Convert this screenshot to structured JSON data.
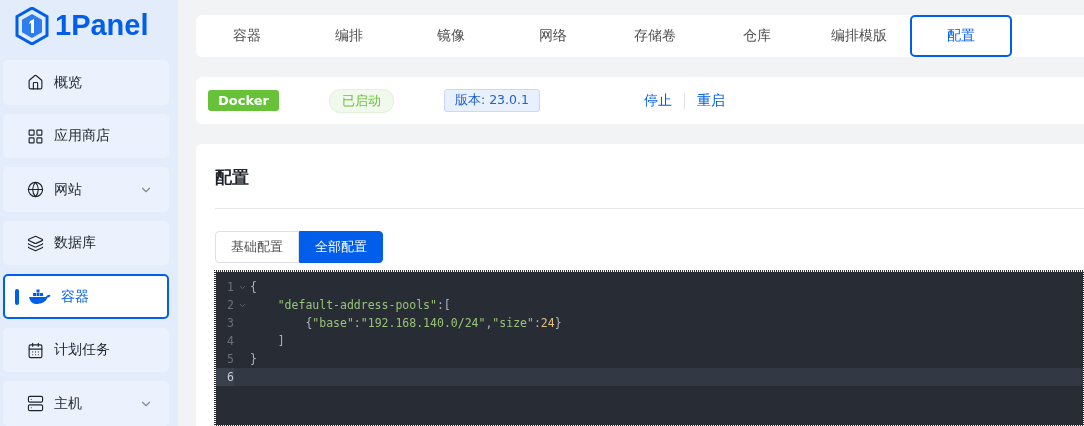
{
  "logo": {
    "text": "1Panel"
  },
  "sidebar": {
    "items": [
      {
        "kind": "home",
        "label": "概览",
        "expandable": false,
        "selected": false
      },
      {
        "kind": "grid",
        "label": "应用商店",
        "expandable": false,
        "selected": false
      },
      {
        "kind": "globe",
        "label": "网站",
        "expandable": true,
        "selected": false
      },
      {
        "kind": "layers",
        "label": "数据库",
        "expandable": false,
        "selected": false
      },
      {
        "kind": "docker",
        "label": "容器",
        "expandable": false,
        "selected": true
      },
      {
        "kind": "calendar",
        "label": "计划任务",
        "expandable": false,
        "selected": false
      },
      {
        "kind": "server",
        "label": "主机",
        "expandable": true,
        "selected": false
      }
    ]
  },
  "tabs": [
    {
      "label": "容器",
      "selected": false
    },
    {
      "label": "编排",
      "selected": false
    },
    {
      "label": "镜像",
      "selected": false
    },
    {
      "label": "网络",
      "selected": false
    },
    {
      "label": "存储卷",
      "selected": false
    },
    {
      "label": "仓库",
      "selected": false
    },
    {
      "label": "编排模版",
      "selected": false
    },
    {
      "label": "配置",
      "selected": true
    }
  ],
  "status_bar": {
    "app": "Docker",
    "status": "已启动",
    "version": "版本: 23.0.1",
    "actions": [
      "停止",
      "重启"
    ]
  },
  "config": {
    "title": "配置",
    "modes": [
      {
        "label": "基础配置",
        "selected": false
      },
      {
        "label": "全部配置",
        "selected": true
      }
    ],
    "editor": {
      "lines": [
        {
          "number": "1",
          "foldable": true,
          "active": false,
          "tokens": [
            {
              "kind": "punct",
              "text": "{"
            }
          ]
        },
        {
          "number": "2",
          "foldable": true,
          "active": false,
          "tokens": [
            {
              "kind": "key",
              "text": "    \"default-address-pools\""
            },
            {
              "kind": "punct",
              "text": ":["
            }
          ]
        },
        {
          "number": "3",
          "foldable": false,
          "active": false,
          "tokens": [
            {
              "kind": "punct",
              "text": "        {"
            },
            {
              "kind": "key",
              "text": "\"base\""
            },
            {
              "kind": "punct",
              "text": ":"
            },
            {
              "kind": "string",
              "text": "\"192.168.140.0/24\""
            },
            {
              "kind": "punct",
              "text": ","
            },
            {
              "kind": "key",
              "text": "\"size\""
            },
            {
              "kind": "punct",
              "text": ":"
            },
            {
              "kind": "number",
              "text": "24"
            },
            {
              "kind": "punct",
              "text": "}"
            }
          ]
        },
        {
          "number": "4",
          "foldable": false,
          "active": false,
          "tokens": [
            {
              "kind": "punct",
              "text": "    ]"
            }
          ]
        },
        {
          "number": "5",
          "foldable": false,
          "active": false,
          "tokens": [
            {
              "kind": "punct",
              "text": "}"
            }
          ]
        },
        {
          "number": "6",
          "foldable": false,
          "active": true
        }
      ]
    }
  }
}
